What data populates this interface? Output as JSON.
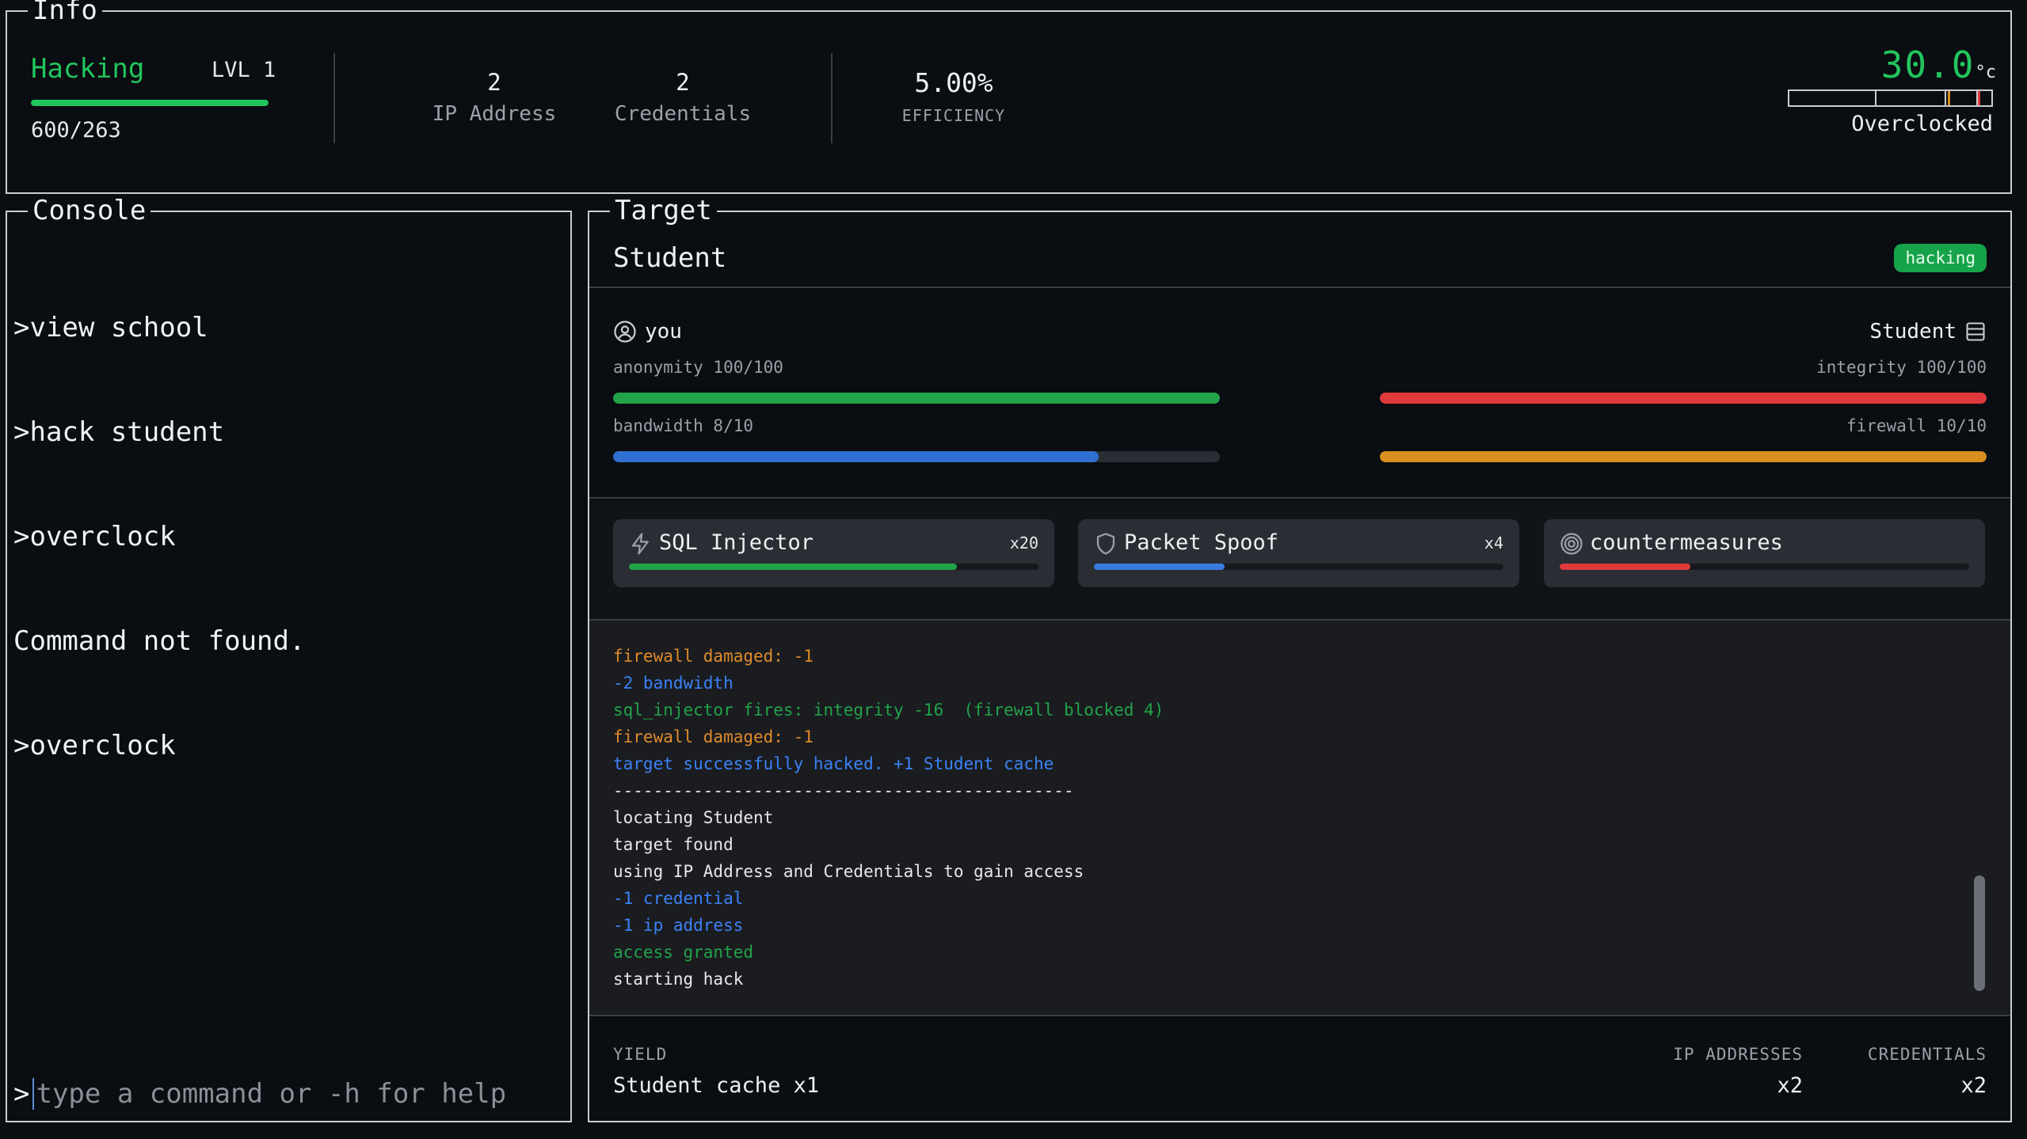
{
  "info": {
    "title": "Info",
    "skill": "Hacking",
    "level": "LVL 1",
    "xp": "600/263",
    "xp_fraction": 1.0,
    "ip_count": "2",
    "ip_label": "IP Address",
    "cred_count": "2",
    "cred_label": "Credentials",
    "efficiency_value": "5.00%",
    "efficiency_label": "EFFICIENCY",
    "temperature": "30.0",
    "temperature_unit": "°c",
    "temperature_state": "Overclocked"
  },
  "console": {
    "title": "Console",
    "lines": [
      ">view school",
      ">hack student",
      ">overclock",
      "Command not found.",
      ">overclock"
    ],
    "prompt": ">",
    "placeholder": "type a command or -h for help"
  },
  "target": {
    "title": "Target",
    "name": "Student",
    "status_badge": "hacking",
    "you": {
      "label": "you",
      "anonymity_label": "anonymity 100/100",
      "anonymity_fraction": 1.0,
      "bandwidth_label": "bandwidth 8/10",
      "bandwidth_fraction": 0.8
    },
    "enemy": {
      "label": "Student",
      "integrity_label": "integrity 100/100",
      "integrity_fraction": 1.0,
      "firewall_label": "firewall 10/10",
      "firewall_fraction": 1.0
    },
    "tools": [
      {
        "name": "SQL Injector",
        "count": "x20",
        "progress": 0.8,
        "color": "#22a34a",
        "icon": "bolt-icon"
      },
      {
        "name": "Packet Spoof",
        "count": "x4",
        "progress": 0.32,
        "color": "#3b7be0",
        "icon": "shield-icon"
      },
      {
        "name": "countermeasures",
        "count": "",
        "progress": 0.32,
        "color": "#e0393b",
        "icon": "spiral-icon"
      }
    ],
    "log": [
      {
        "text": "firewall damaged: -1",
        "color": "#e08a2a"
      },
      {
        "text": "-2 bandwidth",
        "color": "#3b82f6"
      },
      {
        "text": "sql_injector fires: integrity -16  (firewall blocked 4)",
        "color": "#22a34a"
      },
      {
        "text": "firewall damaged: -1",
        "color": "#e08a2a"
      },
      {
        "text": "target successfully hacked. +1 Student cache",
        "color": "#3b82f6"
      },
      {
        "text": "----------------------------------------------",
        "color": "#e6e8ea"
      },
      {
        "text": "locating Student",
        "color": "#e6e8ea"
      },
      {
        "text": "target found",
        "color": "#e6e8ea"
      },
      {
        "text": "using IP Address and Credentials to gain access",
        "color": "#e6e8ea"
      },
      {
        "text": "-1 credential",
        "color": "#3b82f6"
      },
      {
        "text": "-1 ip address",
        "color": "#3b82f6"
      },
      {
        "text": "access granted",
        "color": "#22a34a"
      },
      {
        "text": "starting hack",
        "color": "#e6e8ea"
      }
    ],
    "yield": {
      "label": "YIELD",
      "value": "Student cache x1",
      "ip_label": "IP ADDRESSES",
      "ip_value": "x2",
      "cred_label": "CREDENTIALS",
      "cred_value": "x2"
    }
  },
  "colors": {
    "accent_green": "#22c55e",
    "bar_green": "#22a34a",
    "bar_blue": "#2f6fd0",
    "bar_red": "#e0393b",
    "bar_orange": "#d88f1f"
  }
}
